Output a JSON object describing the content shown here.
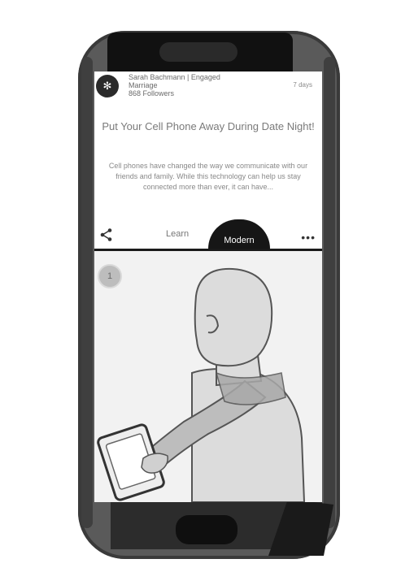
{
  "post": {
    "avatar_glyph": "✻",
    "author_line1": "Sarah Bachmann | Engaged",
    "author_line2": "Marriage",
    "author_line3": "868 Followers",
    "time": "7 days",
    "title": "Put Your Cell Phone Away During Date Night!",
    "body": "Cell phones have changed the way we communicate with our friends and family. While this technology can help us stay connected more than ever, it can have..."
  },
  "actions": {
    "learn_label": "Learn",
    "modern_label": "Modern",
    "more_label": "•••"
  },
  "media": {
    "badge": "1"
  },
  "icons": [
    "share-icon",
    "more-icon",
    "home-button"
  ]
}
